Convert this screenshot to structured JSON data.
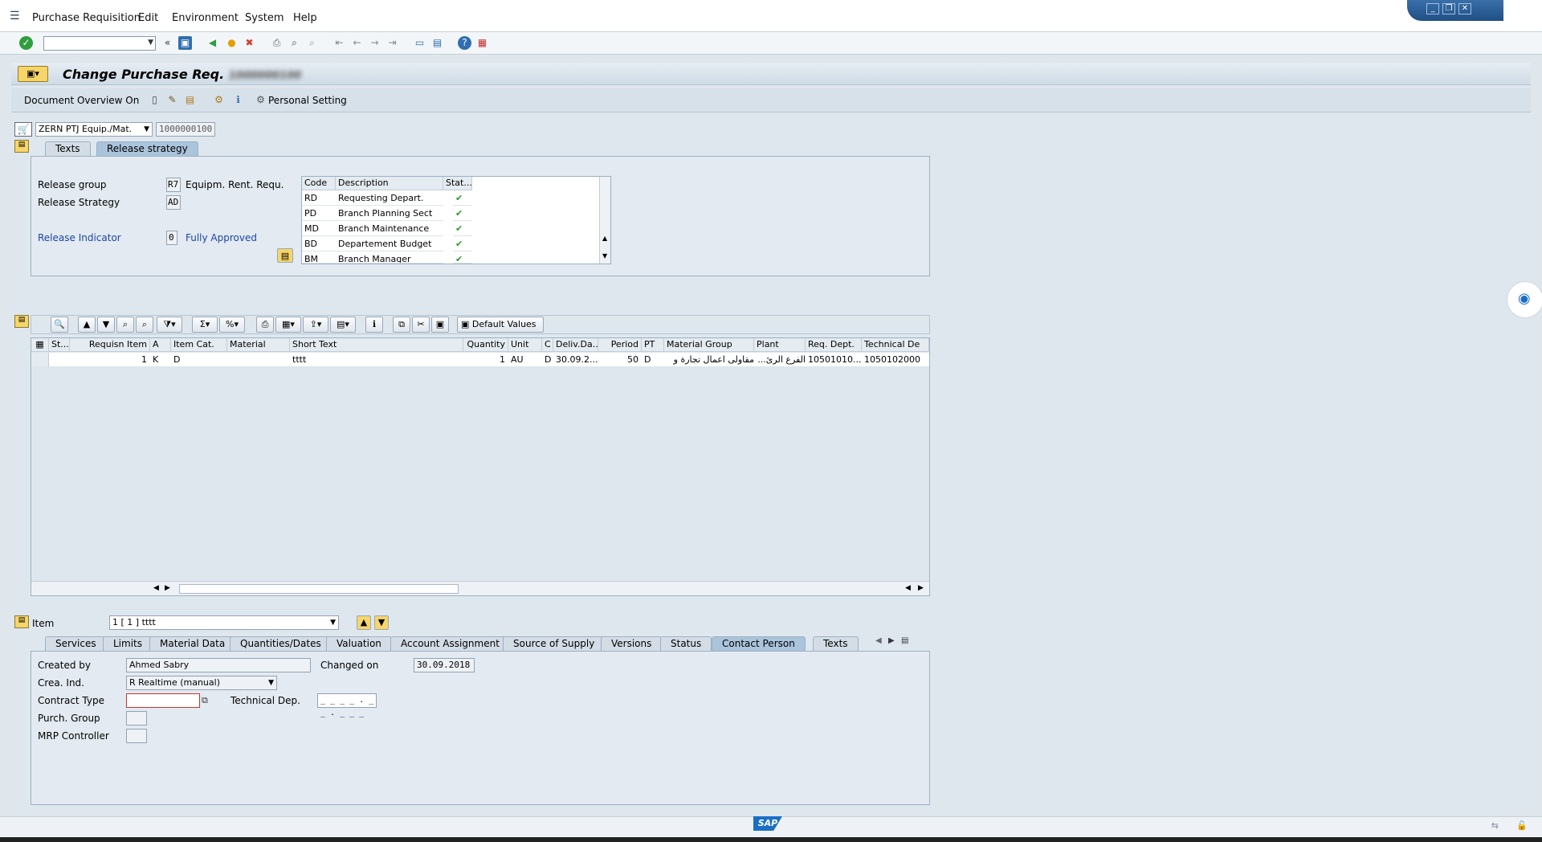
{
  "menu": [
    "Purchase Requisition",
    "Edit",
    "Environment",
    "System",
    "Help"
  ],
  "title": "Change Purchase Req.",
  "title_number": "1000000100",
  "appbar": {
    "doc_overview": "Document Overview On",
    "personal_setting": "Personal Setting"
  },
  "doc_type": "ZERN PTJ Equip./Mat.",
  "doc_number": "1000000100",
  "header_tabs": [
    "Texts",
    "Release strategy"
  ],
  "release": {
    "group_label": "Release group",
    "group_value": "R7",
    "group_desc": "Equipm. Rent. Requ.",
    "strategy_label": "Release Strategy",
    "strategy_value": "AD",
    "indicator_label": "Release Indicator",
    "indicator_value": "0",
    "indicator_desc": "Fully Approved",
    "headers": [
      "Code",
      "Description",
      "Stat..."
    ],
    "rows": [
      {
        "code": "RD",
        "desc": "Requesting Depart."
      },
      {
        "code": "PD",
        "desc": "Branch Planning Sect"
      },
      {
        "code": "MD",
        "desc": "Branch Maintenance"
      },
      {
        "code": "BD",
        "desc": "Departement Budget"
      },
      {
        "code": "BM",
        "desc": "Branch Manager"
      }
    ]
  },
  "item_toolbar": {
    "default_values": "Default Values"
  },
  "item_grid": {
    "headers": [
      "St...",
      "Requisn Item",
      "A",
      "Item Cat.",
      "Material",
      "Short Text",
      "Quantity",
      "Unit",
      "C",
      "Deliv.Da...",
      "Period",
      "PT",
      "Material Group",
      "Plant",
      "Req. Dept.",
      "Technical De"
    ],
    "row": [
      "",
      "1",
      "K",
      "D",
      "",
      "tttt",
      "1",
      "AU",
      "D",
      "30.09.2...",
      "50",
      "D",
      "مقاولى اعمال تجارة و",
      "الفرع الرئ...",
      "10501010...",
      "1050102000"
    ]
  },
  "item_detail": {
    "item_label": "Item",
    "item_value": "1 [ 1 ] tttt",
    "tabs": [
      "Services",
      "Limits",
      "Material Data",
      "Quantities/Dates",
      "Valuation",
      "Account Assignment",
      "Source of Supply",
      "Versions",
      "Status",
      "Contact Person",
      "Texts"
    ],
    "created_by_label": "Created by",
    "created_by": "Ahmed Sabry",
    "changed_on_label": "Changed on",
    "changed_on": "30.09.2018",
    "crea_ind_label": "Crea. Ind.",
    "crea_ind": "R Realtime (manual)",
    "contract_type_label": "Contract Type",
    "technical_dep_label": "Technical Dep.",
    "technical_dep": "_ _ _ _ . _ _ . _ _ _",
    "purch_group_label": "Purch. Group",
    "mrp_label": "MRP Controller"
  },
  "colors": {
    "accent": "#aac4dc",
    "check": "#2c9a2c"
  }
}
